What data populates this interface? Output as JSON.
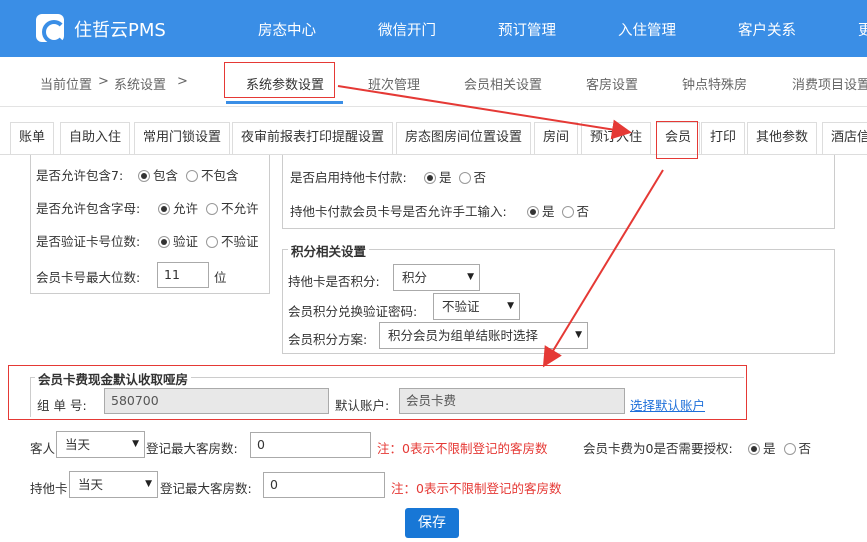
{
  "header": {
    "brand": "住哲云PMS",
    "nav": [
      "房态中心",
      "微信开门",
      "预订管理",
      "入住管理",
      "客户关系",
      "更"
    ]
  },
  "breadcrumb": {
    "prefix": "当前位置",
    "sep": ">",
    "section": "系统设置"
  },
  "page_tabs": [
    "系统参数设置",
    "班次管理",
    "会员相关设置",
    "客房设置",
    "钟点特殊房",
    "消费项目设置"
  ],
  "sub_tabs": [
    "账单",
    "自助入住",
    "常用门锁设置",
    "夜审前报表打印提醒设置",
    "房态图房间位置设置",
    "房间",
    "预订入住",
    "会员",
    "打印",
    "其他参数",
    "酒店信"
  ],
  "left_panel": {
    "rows": [
      {
        "label": "是否允许包含7:",
        "options": [
          "包含",
          "不包含"
        ],
        "selected": 0
      },
      {
        "label": "是否允许包含字母:",
        "options": [
          "允许",
          "不允许"
        ],
        "selected": 0
      },
      {
        "label": "是否验证卡号位数:",
        "options": [
          "验证",
          "不验证"
        ],
        "selected": 0
      }
    ],
    "max_digits_label": "会员卡号最大位数:",
    "max_digits_value": "11",
    "max_digits_unit": "位"
  },
  "right_panel_top": {
    "rows": [
      {
        "label": "是否启用持他卡付款:",
        "options": [
          "是",
          "否"
        ],
        "selected": 0
      },
      {
        "label": "持他卡付款会员卡号是否允许手工输入:",
        "options": [
          "是",
          "否"
        ],
        "selected": 0
      }
    ]
  },
  "points": {
    "legend": "积分相关设置",
    "earn_label": "持他卡是否积分:",
    "earn_value": "积分",
    "verify_label": "会员积分兑换验证密码:",
    "verify_value": "不验证",
    "scheme_label": "会员积分方案:",
    "scheme_value": "积分会员为组单结账时选择"
  },
  "card_fee": {
    "legend": "会员卡费现金默认收取哑房",
    "group_label": "组 单 号:",
    "group_value": "580700",
    "account_label": "默认账户:",
    "account_value": "会员卡费",
    "select_link": "选择默认账户"
  },
  "guest_row": {
    "label": "客人",
    "select_value": "当天",
    "max_rooms_label": "登记最大客房数:",
    "max_rooms_value": "0",
    "note": "注：0表示不限制登记的客房数",
    "auth_label": "会员卡费为0是否需要授权:",
    "auth_options": [
      "是",
      "否"
    ],
    "auth_selected": 0
  },
  "other_card_row": {
    "label": "持他卡",
    "select_value": "当天",
    "max_rooms_label": "登记最大客房数:",
    "max_rooms_value": "0",
    "note": "注：0表示不限制登记的客房数"
  },
  "actions": {
    "save": "保存"
  },
  "colors": {
    "primary": "#3a8ee6",
    "annotation": "#e53935",
    "button": "#1877d6"
  }
}
